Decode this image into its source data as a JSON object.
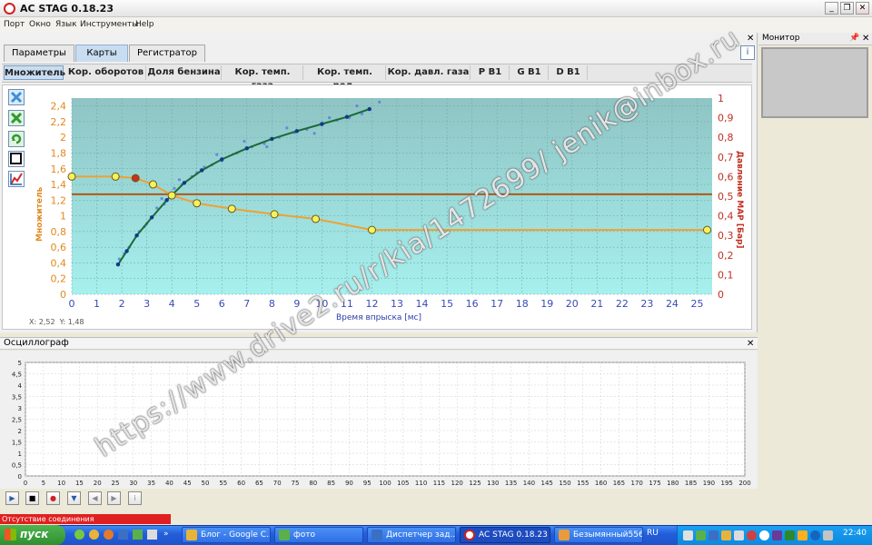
{
  "window": {
    "title": "AC STAG 0.18.23",
    "min": "_",
    "max": "❐",
    "close": "✕"
  },
  "menu": [
    "Порт",
    "Окно",
    "Язык",
    "Инструменты",
    "Help"
  ],
  "main_tabs": [
    {
      "label": "Параметры",
      "active": false
    },
    {
      "label": "Карты",
      "active": true
    },
    {
      "label": "Регистратор",
      "active": false
    }
  ],
  "sub_tabs": [
    {
      "label": "Множитель",
      "active": true
    },
    {
      "label": "Кор. оборотов",
      "active": false
    },
    {
      "label": "Доля бензина",
      "active": false
    },
    {
      "label": "Кор. темп. газа",
      "active": false
    },
    {
      "label": "Кор. темп. ред.",
      "active": false
    },
    {
      "label": "Кор. давл. газа",
      "active": false
    },
    {
      "label": "P B1",
      "active": false
    },
    {
      "label": "G B1",
      "active": false
    },
    {
      "label": "D B1",
      "active": false
    }
  ],
  "toolbar_icons": [
    "zoom-icon",
    "cancel-icon",
    "refresh-icon",
    "select-icon",
    "chart-icon"
  ],
  "readout": {
    "x": "X: 2,52",
    "y": "Y: 1,48"
  },
  "oscillograph": {
    "title": "Осциллограф"
  },
  "controls": [
    "▶",
    "■",
    "●",
    "▼",
    "◀",
    "▶",
    "i"
  ],
  "status": {
    "text": "Отсутствие соединения"
  },
  "monitor": {
    "title": "Монитор"
  },
  "watermark": "https://www.drive2.ru/r/kia/1472699/ jenik@inbox.ru",
  "taskbar": {
    "start": "пуск",
    "items": [
      {
        "label": "Блог - Google C...",
        "active": false,
        "color": "#e8b33a"
      },
      {
        "label": "фото",
        "active": false,
        "color": "#5bb04a"
      },
      {
        "label": "Диспетчер зад...",
        "active": false,
        "color": "#3b6fc4"
      },
      {
        "label": "AC STAG 0.18.23",
        "active": true,
        "color": "#ffffff"
      },
      {
        "label": "Безымянный556...",
        "active": false,
        "color": "#e89b3a"
      }
    ],
    "lang": "RU",
    "clock": "22:40"
  },
  "chart_data": [
    {
      "type": "line",
      "xlabel": "Время впрыска [мс]",
      "ylabel": "Множитель",
      "y2label": "Давление MAP [Бар]",
      "x_ticks": [
        0,
        1,
        2,
        3,
        4,
        5,
        6,
        7,
        8,
        9,
        10,
        11,
        12,
        13,
        14,
        15,
        16,
        17,
        18,
        19,
        20,
        21,
        22,
        23,
        24,
        25
      ],
      "y_ticks": [
        "0",
        "0,2",
        "0,4",
        "0,6",
        "0,8",
        "1",
        "1,2",
        "1,4",
        "1,6",
        "1,8",
        "2",
        "2,2",
        "2,4"
      ],
      "y2_ticks": [
        "0",
        "0,1",
        "0,2",
        "0,3",
        "0,4",
        "0,5",
        "0,6",
        "0,7",
        "0,8",
        "0,9",
        "1"
      ],
      "xlim": [
        0,
        25.6
      ],
      "ylim": [
        0,
        2.5
      ],
      "y2lim": [
        0,
        1
      ],
      "grid": true,
      "colors": {
        "bg_top": "#8fc4c4",
        "bg_bottom": "#a6f0ee",
        "multiplier": "#f0a030",
        "map_line": "#b05818",
        "fit": "#1b6a37",
        "scatter": "#5c7fd8"
      },
      "series": [
        {
          "id": "multiplier",
          "axis": "y",
          "x": [
            0,
            1.75,
            2.55,
            3.25,
            4,
            5,
            6.4,
            8.1,
            9.75,
            12,
            25.4
          ],
          "y": [
            1.5,
            1.5,
            1.48,
            1.4,
            1.26,
            1.16,
            1.09,
            1.02,
            0.96,
            0.82,
            0.82
          ]
        },
        {
          "id": "map",
          "axis": "y2",
          "x": [
            0,
            25.6
          ],
          "y": [
            0.51,
            0.51
          ]
        },
        {
          "id": "fit",
          "axis": "y",
          "x": [
            1.85,
            2.2,
            2.6,
            3.2,
            3.8,
            4.5,
            5.2,
            6,
            7,
            8,
            9,
            10,
            11,
            11.9
          ],
          "y": [
            0.38,
            0.55,
            0.75,
            0.98,
            1.2,
            1.42,
            1.58,
            1.72,
            1.86,
            1.98,
            2.08,
            2.17,
            2.26,
            2.36
          ]
        },
        {
          "id": "samples",
          "axis": "y",
          "x": [
            1.9,
            2.3,
            2.7,
            3.0,
            3.4,
            3.7,
            4.1,
            4.4,
            4.8,
            5.3,
            5.6,
            6.0,
            6.6,
            7.2,
            7.7,
            8.3,
            8.9,
            9.4,
            10.0,
            10.6,
            11.1,
            11.6,
            12.3,
            2.1,
            2.9,
            3.6,
            4.3,
            5.0,
            5.8,
            6.9,
            7.8,
            8.6,
            9.7,
            10.3,
            11.4
          ],
          "y": [
            0.45,
            0.6,
            0.8,
            0.9,
            1.1,
            1.15,
            1.35,
            1.4,
            1.5,
            1.62,
            1.65,
            1.7,
            1.8,
            1.88,
            1.92,
            2.0,
            2.06,
            2.1,
            2.16,
            2.22,
            2.25,
            2.3,
            2.45,
            0.52,
            0.86,
            1.22,
            1.46,
            1.55,
            1.78,
            1.95,
            1.88,
            2.12,
            2.05,
            2.25,
            2.4
          ]
        }
      ]
    },
    {
      "type": "line",
      "title": "",
      "x_ticks": [
        0,
        5,
        10,
        15,
        20,
        25,
        30,
        35,
        40,
        45,
        50,
        55,
        60,
        65,
        70,
        75,
        80,
        85,
        90,
        95,
        100,
        105,
        110,
        115,
        120,
        125,
        130,
        135,
        140,
        145,
        150,
        155,
        160,
        165,
        170,
        175,
        180,
        185,
        190,
        195,
        200
      ],
      "y_ticks": [
        "0",
        "0,5",
        "1",
        "1,5",
        "2",
        "2,5",
        "3",
        "3,5",
        "4",
        "4,5",
        "5"
      ],
      "xlim": [
        0,
        200
      ],
      "ylim": [
        0,
        5
      ],
      "grid": true,
      "series": []
    }
  ]
}
